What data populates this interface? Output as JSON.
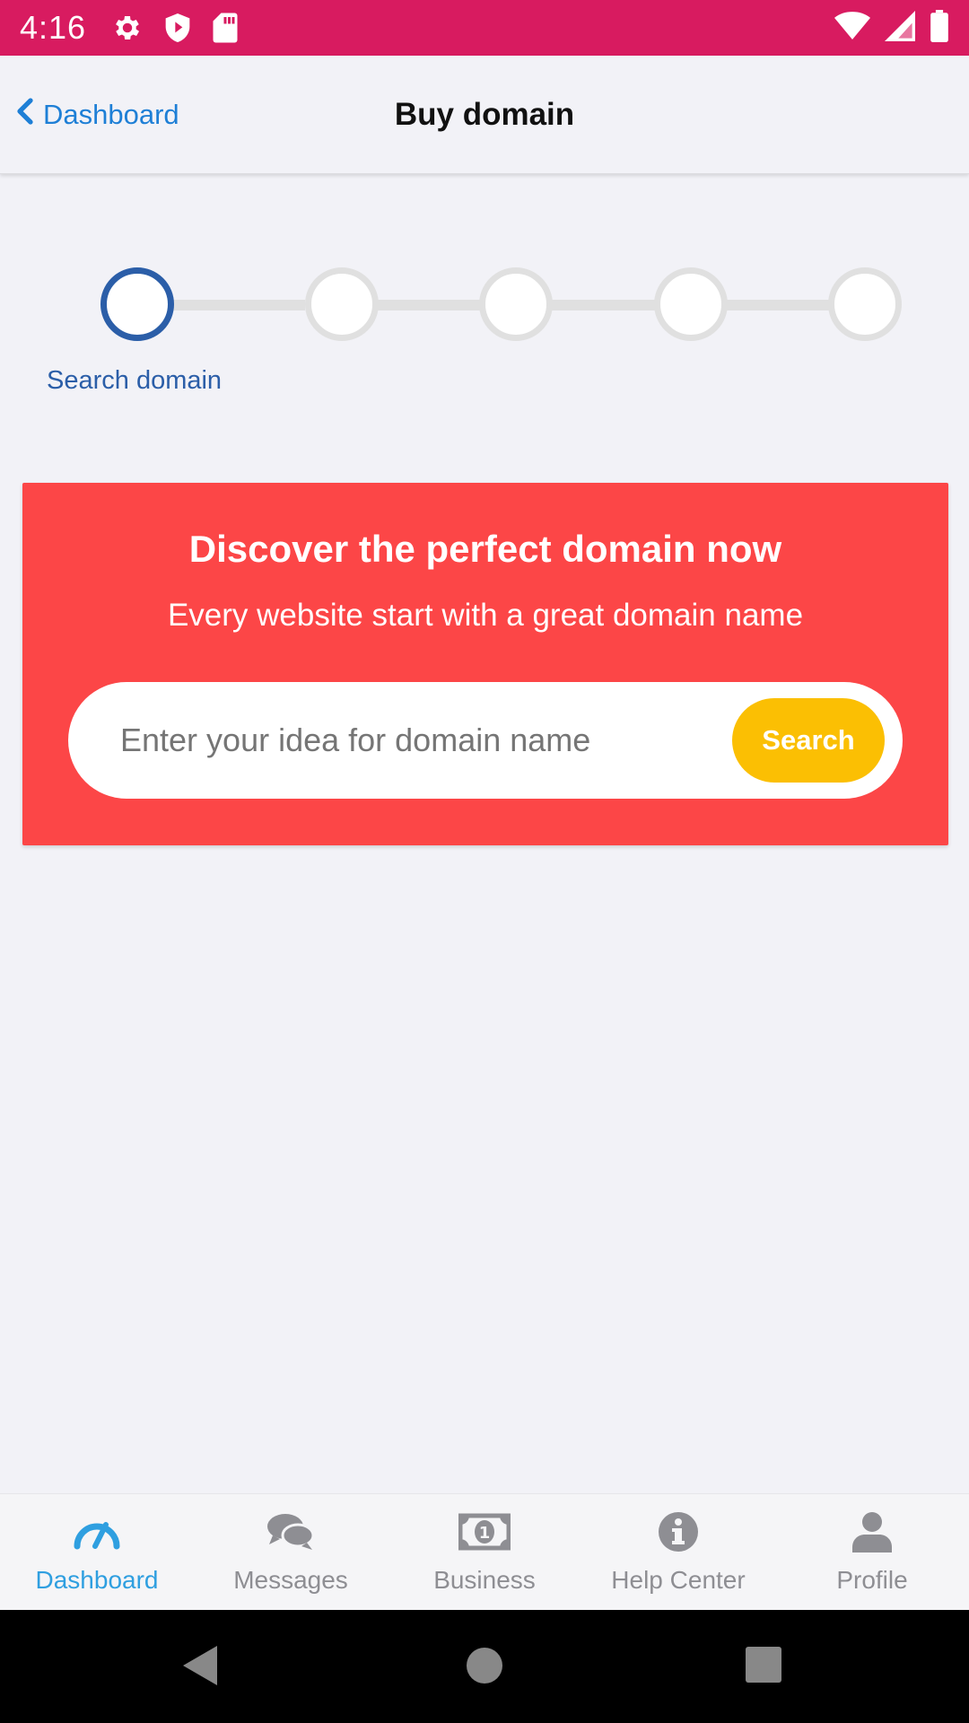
{
  "status_bar": {
    "time": "4:16",
    "icons_left": [
      "gear-icon",
      "shield-icon",
      "sd-card-icon"
    ],
    "icons_right": [
      "wifi-icon",
      "cell-signal-icon",
      "battery-icon"
    ],
    "color": "#d81b60"
  },
  "header": {
    "back_label": "Dashboard",
    "title": "Buy domain"
  },
  "stepper": {
    "steps": 5,
    "active_step": 1,
    "active_label": "Search domain",
    "active_color": "#2b5ea8"
  },
  "promo": {
    "title": "Discover the perfect domain now",
    "subtitle": "Every website start with a great domain name",
    "search_placeholder": "Enter your idea for domain name",
    "search_button": "Search",
    "background_color": "#fc4647",
    "button_color": "#fbbf03"
  },
  "tabs": [
    {
      "label": "Dashboard",
      "icon": "speedometer-icon",
      "active": true
    },
    {
      "label": "Messages",
      "icon": "chat-bubbles-icon",
      "active": false
    },
    {
      "label": "Business",
      "icon": "banknote-icon",
      "active": false
    },
    {
      "label": "Help Center",
      "icon": "info-icon",
      "active": false
    },
    {
      "label": "Profile",
      "icon": "user-icon",
      "active": false
    }
  ],
  "nav_bar": {
    "buttons": [
      "back-icon",
      "home-icon",
      "recents-icon"
    ]
  }
}
